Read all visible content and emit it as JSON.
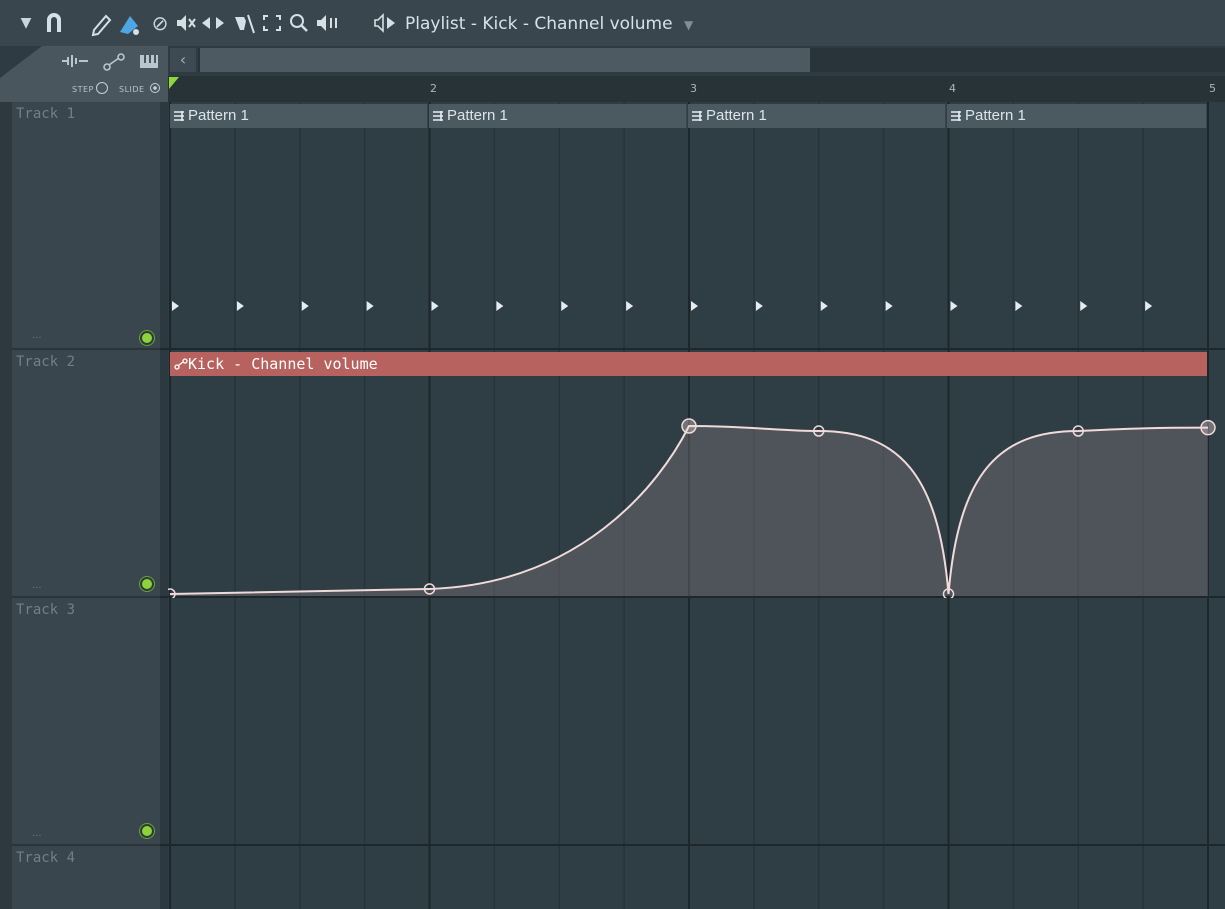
{
  "window": {
    "title": "Playlist - Kick - Channel volume"
  },
  "toolbar": {
    "icons": [
      "menu-arrow-icon",
      "magnet-icon",
      "pencil-icon",
      "paint-icon",
      "delete-icon",
      "mute-icon",
      "slip-icon",
      "slice-icon",
      "select-icon",
      "zoom-icon",
      "playback-icon",
      "speaker-icon"
    ]
  },
  "tool_panel": {
    "step_label": "STEP",
    "slide_label": "SLIDE"
  },
  "ruler": {
    "bars": [
      "2",
      "3",
      "4",
      "5"
    ]
  },
  "tracks": [
    {
      "name": "Track 1",
      "dots": "..."
    },
    {
      "name": "Track 2",
      "dots": "..."
    },
    {
      "name": "Track 3",
      "dots": "..."
    },
    {
      "name": "Track 4"
    }
  ],
  "pattern_clips": [
    {
      "label": "Pattern 1"
    },
    {
      "label": "Pattern 1"
    },
    {
      "label": "Pattern 1"
    },
    {
      "label": "Pattern 1"
    }
  ],
  "automation_clip": {
    "label": "Kick - Channel volume",
    "color": "#b8625f",
    "points": [
      {
        "bar": 1,
        "value": 0.0
      },
      {
        "bar": 2,
        "value": 0.03
      },
      {
        "bar": 3,
        "value": 1.0
      },
      {
        "bar": 3.5,
        "value": 0.97
      },
      {
        "bar": 4,
        "value": 0.0
      },
      {
        "bar": 4.5,
        "value": 0.97
      },
      {
        "bar": 5,
        "value": 0.99
      }
    ]
  },
  "colors": {
    "accent_green": "#8fd33a",
    "automation_curve": "#f0dada"
  }
}
